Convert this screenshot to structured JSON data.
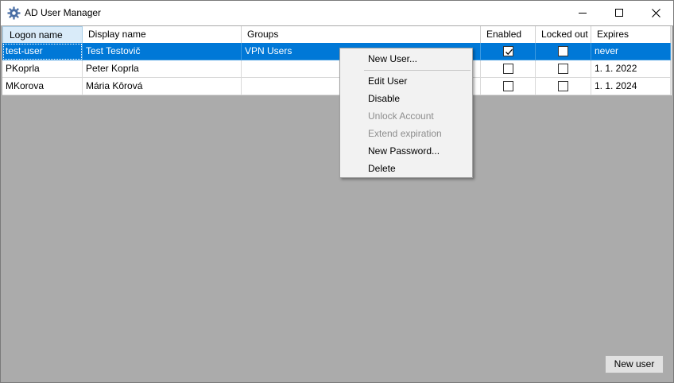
{
  "window": {
    "title": "AD User Manager"
  },
  "grid": {
    "columns": [
      "Logon name",
      "Display name",
      "Groups",
      "Enabled",
      "Locked out",
      "Expires"
    ],
    "rows": [
      {
        "logon": "test-user",
        "display": "Test Testovič",
        "groups": "VPN Users",
        "enabled": true,
        "locked": false,
        "expires": "never",
        "selected": true
      },
      {
        "logon": "PKoprla",
        "display": "Peter Koprla",
        "groups": "",
        "enabled": false,
        "locked": false,
        "expires": "1. 1. 2022",
        "selected": false
      },
      {
        "logon": "MKorova",
        "display": "Mária Kôrová",
        "groups": "",
        "enabled": false,
        "locked": false,
        "expires": "1. 1. 2024",
        "selected": false
      }
    ]
  },
  "context_menu": {
    "items": [
      {
        "label": "New User...",
        "enabled": true
      },
      {
        "label": "Edit User",
        "enabled": true
      },
      {
        "label": "Disable",
        "enabled": true
      },
      {
        "label": "Unlock Account",
        "enabled": false
      },
      {
        "label": "Extend expiration",
        "enabled": false
      },
      {
        "label": "New Password...",
        "enabled": true
      },
      {
        "label": "Delete",
        "enabled": true
      }
    ]
  },
  "footer": {
    "new_user_label": "New user"
  },
  "colors": {
    "selection": "#0078d7",
    "workspace": "#ababab",
    "menu_bg": "#f2f2f2",
    "disabled_text": "#8d8d8d"
  }
}
